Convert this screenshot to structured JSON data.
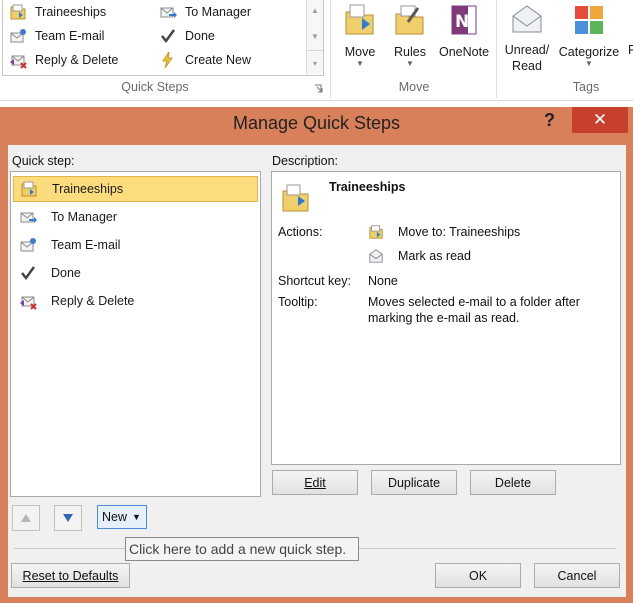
{
  "ribbon": {
    "quick_steps_gallery": [
      {
        "label": "Traineeships",
        "icon": "folder-move-icon"
      },
      {
        "label": "To Manager",
        "icon": "forward-mail-icon"
      },
      {
        "label": "Team E-mail",
        "icon": "team-mail-icon"
      },
      {
        "label": "Done",
        "icon": "checkmark-icon"
      },
      {
        "label": "Reply & Delete",
        "icon": "reply-delete-icon"
      },
      {
        "label": "Create New",
        "icon": "lightning-icon"
      }
    ],
    "group_quick_steps": "Quick Steps",
    "group_move": "Move",
    "group_tags": "Tags",
    "move_label": "Move",
    "rules_label": "Rules",
    "onenote_label": "OneNote",
    "unread_read_label_1": "Unread/",
    "unread_read_label_2": "Read",
    "categorize_label": "Categorize",
    "partial_label": "F"
  },
  "dialog": {
    "title": "Manage Quick Steps",
    "help": "?",
    "close": "✕",
    "quick_step_label": "Quick step:",
    "description_label": "Description:",
    "steps": [
      {
        "label": "Traineeships",
        "icon": "folder-move-icon",
        "selected": true
      },
      {
        "label": "To Manager",
        "icon": "forward-mail-icon",
        "selected": false
      },
      {
        "label": "Team E-mail",
        "icon": "team-mail-icon",
        "selected": false
      },
      {
        "label": "Done",
        "icon": "checkmark-icon",
        "selected": false
      },
      {
        "label": "Reply & Delete",
        "icon": "reply-delete-icon",
        "selected": false
      }
    ],
    "description": {
      "name": "Traineeships",
      "actions_label": "Actions:",
      "actions": [
        {
          "text": "Move to: Traineeships",
          "icon": "folder-move-icon"
        },
        {
          "text": "Mark as read",
          "icon": "read-envelope-icon"
        }
      ],
      "shortcut_label": "Shortcut key:",
      "shortcut_value": "None",
      "tooltip_label": "Tooltip:",
      "tooltip_line1": "Moves selected e-mail to a folder after",
      "tooltip_line2": "marking the e-mail as read."
    },
    "buttons": {
      "edit": "Edit",
      "duplicate": "Duplicate",
      "delete": "Delete",
      "new": "New",
      "reset": "Reset to Defaults",
      "ok": "OK",
      "cancel": "Cancel"
    },
    "tooltip_text": "Click here to add a new quick step.",
    "colors": {
      "frame": "#d8805a",
      "close": "#c7402e",
      "selection": "#fddc7d"
    }
  }
}
